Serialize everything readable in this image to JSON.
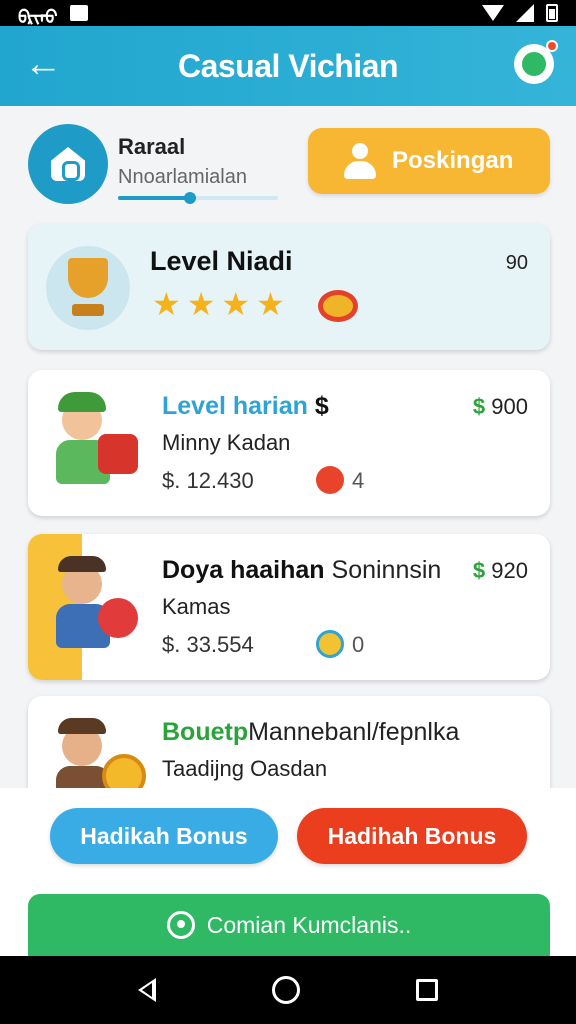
{
  "status_bar": {
    "time": "ᠪᠷᠢᠠᠣ"
  },
  "header": {
    "title": "Casual Vichian",
    "back_icon": "arrow-left-icon",
    "chat_icon": "chat-bubble-icon"
  },
  "profile": {
    "name": "Raraal",
    "subtitle": "Nnoarlamialan",
    "progress": 0.45,
    "action_label": "Poskingan"
  },
  "level": {
    "title": "Level Niadi",
    "value": "90",
    "stars": 4
  },
  "tasks": [
    {
      "title_colored": "Level harian",
      "title_rest": "$",
      "price_symbol": "$",
      "price": "900",
      "subtitle": "Minny Kadan",
      "amount": "$. 12.430",
      "count": "4"
    },
    {
      "title_colored": "Doya haaihan",
      "title_rest": "Soninnsin",
      "price_symbol": "$",
      "price": "920",
      "subtitle": "Kamas",
      "amount": "$. 33.554",
      "count": "0"
    },
    {
      "title_colored": "Bouetp",
      "title_rest": "Mannebanl/fepnlka",
      "subtitle": "Taadijng Oasdan"
    }
  ],
  "buttons": {
    "bonus_left": "Hadikah Bonus",
    "bonus_right": "Hadihah Bonus",
    "primary": "Comian Kumclanis.."
  },
  "colors": {
    "header": "#21a6cf",
    "accent_yellow": "#f7b733",
    "green": "#2fb964",
    "red": "#ea3e1e",
    "blue": "#3aace5"
  }
}
